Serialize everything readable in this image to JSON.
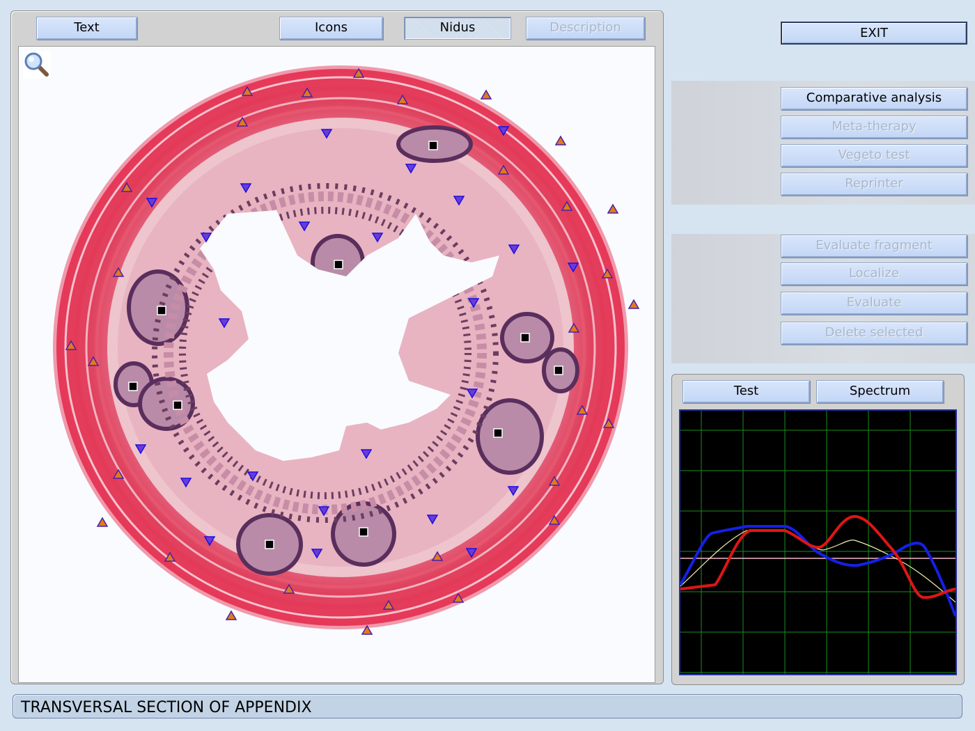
{
  "viewer": {
    "tabs": [
      {
        "label": "Text"
      },
      {
        "label": "Icons"
      },
      {
        "label": "Nidus"
      },
      {
        "label": "Description"
      }
    ],
    "zoom_icon": "magnifier-icon"
  },
  "actions": {
    "exit_label": "EXIT",
    "group1": [
      {
        "label": "Comparative analysis"
      },
      {
        "label": "Meta-therapy"
      },
      {
        "label": "Vegeto test"
      },
      {
        "label": "Reprinter"
      }
    ],
    "group2": [
      {
        "label": "Evaluate fragment"
      },
      {
        "label": "Localize"
      },
      {
        "label": "Evaluate"
      },
      {
        "label": "Delete selected"
      }
    ]
  },
  "graph_panel": {
    "tabs": [
      {
        "label": "Test"
      },
      {
        "label": "Spectrum"
      }
    ],
    "colors": {
      "background": "#000000",
      "grid": "#1a8f1a",
      "red": "#e01515",
      "blue": "#1420e6",
      "yellow": "#f0f0b0",
      "baseline": "#f4b8c8"
    }
  },
  "status": {
    "text": "TRANSVERSAL SECTION OF APPENDIX"
  }
}
